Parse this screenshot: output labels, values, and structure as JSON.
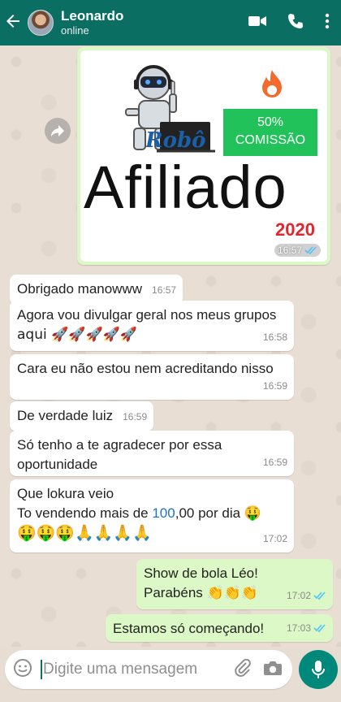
{
  "header": {
    "contact_name": "Leonardo",
    "status": "online",
    "icons": [
      "back-arrow-icon",
      "video-call-icon",
      "voice-call-icon",
      "more-options-icon"
    ]
  },
  "image_message": {
    "badge_line1": "50%",
    "badge_line2": "COMISSÃO",
    "logo_small": "Robô",
    "logo_word": "Afiliado",
    "logo_year": "2020",
    "time": "16:57"
  },
  "messages": [
    {
      "text": "Obrigado manowww",
      "time": "16:57"
    },
    {
      "line1": "Agora vou divulgar geral nos meus grupos",
      "line2": "aqui 🚀🚀🚀🚀🚀",
      "time": "16:58"
    },
    {
      "text": "Cara eu não estou nem acreditando nisso",
      "time": "16:59"
    },
    {
      "text": "De verdade luiz",
      "time": "16:59"
    },
    {
      "line1": "Só tenho a te agradecer por essa",
      "line2": "oportunidade",
      "time": "16:59"
    },
    {
      "line1": "Que lokura veio",
      "line2_pre": "To vendendo mais de ",
      "line2_num": "100",
      "line2_post": ",00 por dia 🤑",
      "line3": "🤑🤑🤑🙏🙏🙏🙏",
      "time": "17:02"
    }
  ],
  "outgoing": [
    {
      "line1": "Show de bola Léo!",
      "line2": "Parabéns 👏👏👏",
      "time": "17:02"
    },
    {
      "text": "Estamos só começando!",
      "time": "17:03"
    }
  ],
  "composer": {
    "placeholder": "Digite uma mensagem"
  },
  "colors": {
    "header": "#0b6e63",
    "outgoing_bubble": "#dcf8c6",
    "read_ticks": "#4fc3f7",
    "mic_button": "#00897b"
  }
}
